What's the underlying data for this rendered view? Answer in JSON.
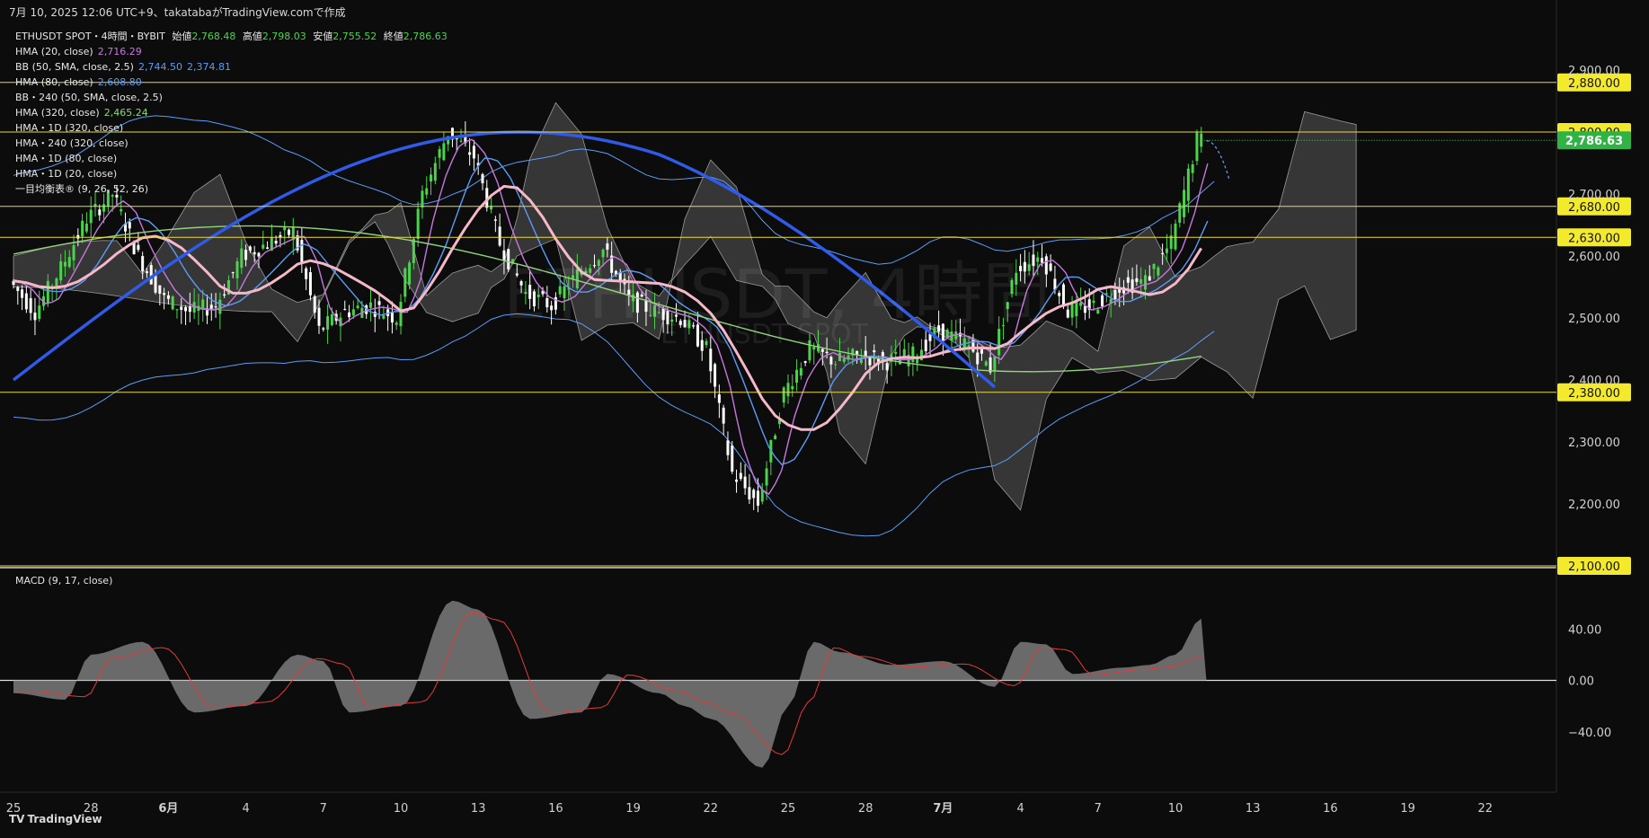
{
  "header": {
    "text": "7月 10, 2025 12:06 UTC+9、takatabaがTradingView.comで作成"
  },
  "symbol_line": {
    "symbol": "ETHUSDT SPOT・4時間・BYBIT",
    "open_label": "始値",
    "open": "2,768.48",
    "high_label": "高値",
    "high": "2,798.03",
    "low_label": "安値",
    "low": "2,755.52",
    "close_label": "終値",
    "close": "2,786.63"
  },
  "indicators": [
    {
      "label": "HMA (20, close)",
      "value": "2,716.29",
      "color": "#c678dd"
    },
    {
      "label": "BB (50, SMA, close, 2.5)",
      "value": "2,744.50",
      "value2": "2,374.81",
      "color": "#5b9cf6"
    },
    {
      "label": "HMA (80, close)",
      "value": "2,608.80",
      "color": "#5b9cf6"
    },
    {
      "label": "BB・240 (50, SMA, close, 2.5)",
      "value": "",
      "color": "#5b9cf6"
    },
    {
      "label": "HMA (320, close)",
      "value": "2,465.24",
      "color": "#8fd47a"
    },
    {
      "label": "HMA・1D (320, close)",
      "value": "",
      "color": "#ffffff"
    },
    {
      "label": "HMA・240 (320, close)",
      "value": "",
      "color": "#ffffff"
    },
    {
      "label": "HMA・1D (80, close)",
      "value": "",
      "color": "#ffffff"
    },
    {
      "label": "HMA・1D (20, close)",
      "value": "",
      "color": "#ffffff"
    },
    {
      "label": "一目均衡表® (9, 26, 52, 26)",
      "value": "",
      "color": "#ffffff"
    }
  ],
  "watermark": {
    "main": "ETHUSDT, 4時間",
    "sub": "ETHUSDT SPOT"
  },
  "macd_label": "MACD (9, 17, close)",
  "price_axis": [
    "2,900.00",
    "2,700.00",
    "2,600.00",
    "2,500.00",
    "2,400.00",
    "2,300.00",
    "2,200.00"
  ],
  "price_levels": [
    {
      "label": "2,880.00",
      "value": 2880
    },
    {
      "label": "2,800.00",
      "value": 2800
    },
    {
      "label": "2,680.00",
      "value": 2680
    },
    {
      "label": "2,630.00",
      "value": 2630
    },
    {
      "label": "2,380.00",
      "value": 2380
    },
    {
      "label": "2,100.00",
      "value": 2100
    }
  ],
  "last_price": {
    "label": "2,786.63",
    "value": 2786.63
  },
  "macd_axis": [
    "40.00",
    "0.00",
    "−40.00"
  ],
  "time_axis": [
    {
      "label": "25",
      "bold": false
    },
    {
      "label": "28",
      "bold": false
    },
    {
      "label": "6月",
      "bold": true
    },
    {
      "label": "4",
      "bold": false
    },
    {
      "label": "7",
      "bold": false
    },
    {
      "label": "10",
      "bold": false
    },
    {
      "label": "13",
      "bold": false
    },
    {
      "label": "16",
      "bold": false
    },
    {
      "label": "19",
      "bold": false
    },
    {
      "label": "22",
      "bold": false
    },
    {
      "label": "25",
      "bold": false
    },
    {
      "label": "28",
      "bold": false
    },
    {
      "label": "7月",
      "bold": true
    },
    {
      "label": "4",
      "bold": false
    },
    {
      "label": "7",
      "bold": false
    },
    {
      "label": "10",
      "bold": false
    },
    {
      "label": "13",
      "bold": false
    },
    {
      "label": "16",
      "bold": false
    },
    {
      "label": "19",
      "bold": false
    },
    {
      "label": "22",
      "bold": false
    }
  ],
  "footer": {
    "logo": "TV",
    "text": "TradingView"
  },
  "colors": {
    "background": "#0c0c0c",
    "up": "#4cd34c",
    "down": "#ffffff",
    "level": "#e8d84a",
    "hma20": "#c678dd",
    "hma80": "#5b9cf6",
    "hma320": "#8fd47a",
    "hma_1d_320": "#2f5be8",
    "hma_240_320": "#f5b8c8",
    "cloud": "#5a5a5a",
    "macd_line": "#e23b3b",
    "macd_hist": "#8a8a8a"
  },
  "chart_data": {
    "type": "candlestick",
    "symbol": "ETHUSDT SPOT",
    "interval": "4時間",
    "exchange": "BYBIT",
    "y_range": [
      2100,
      2930
    ],
    "x_range": [
      "2025-05-25",
      "2025-07-23"
    ],
    "last_ohlc": {
      "open": 2768.48,
      "high": 2798.03,
      "low": 2755.52,
      "close": 2786.63
    },
    "price_path": [
      {
        "x": "05-25",
        "y": 2560
      },
      {
        "x": "05-26",
        "y": 2510
      },
      {
        "x": "05-27",
        "y": 2580
      },
      {
        "x": "05-28",
        "y": 2660
      },
      {
        "x": "05-29",
        "y": 2700
      },
      {
        "x": "05-30",
        "y": 2600
      },
      {
        "x": "05-31",
        "y": 2530
      },
      {
        "x": "06-01",
        "y": 2510
      },
      {
        "x": "06-02",
        "y": 2520
      },
      {
        "x": "06-03",
        "y": 2600
      },
      {
        "x": "06-04",
        "y": 2620
      },
      {
        "x": "06-05",
        "y": 2640
      },
      {
        "x": "06-06",
        "y": 2480
      },
      {
        "x": "06-07",
        "y": 2510
      },
      {
        "x": "06-08",
        "y": 2520
      },
      {
        "x": "06-09",
        "y": 2500
      },
      {
        "x": "06-10",
        "y": 2700
      },
      {
        "x": "06-11",
        "y": 2800
      },
      {
        "x": "06-12",
        "y": 2760
      },
      {
        "x": "06-13",
        "y": 2620
      },
      {
        "x": "06-14",
        "y": 2540
      },
      {
        "x": "06-15",
        "y": 2520
      },
      {
        "x": "06-16",
        "y": 2570
      },
      {
        "x": "06-17",
        "y": 2610
      },
      {
        "x": "06-18",
        "y": 2530
      },
      {
        "x": "06-19",
        "y": 2510
      },
      {
        "x": "06-20",
        "y": 2500
      },
      {
        "x": "06-21",
        "y": 2450
      },
      {
        "x": "06-22",
        "y": 2250
      },
      {
        "x": "06-23",
        "y": 2200
      },
      {
        "x": "06-24",
        "y": 2380
      },
      {
        "x": "06-25",
        "y": 2450
      },
      {
        "x": "06-26",
        "y": 2430
      },
      {
        "x": "06-27",
        "y": 2440
      },
      {
        "x": "06-28",
        "y": 2430
      },
      {
        "x": "06-29",
        "y": 2440
      },
      {
        "x": "06-30",
        "y": 2480
      },
      {
        "x": "07-01",
        "y": 2460
      },
      {
        "x": "07-02",
        "y": 2420
      },
      {
        "x": "07-03",
        "y": 2580
      },
      {
        "x": "07-04",
        "y": 2600
      },
      {
        "x": "07-05",
        "y": 2510
      },
      {
        "x": "07-06",
        "y": 2520
      },
      {
        "x": "07-07",
        "y": 2550
      },
      {
        "x": "07-08",
        "y": 2560
      },
      {
        "x": "07-09",
        "y": 2620
      },
      {
        "x": "07-10",
        "y": 2786.63
      }
    ],
    "series": [
      {
        "name": "HMA (20, close)",
        "last": 2716.29
      },
      {
        "name": "HMA (80, close)",
        "last": 2608.8
      },
      {
        "name": "HMA (320, close)",
        "last": 2465.24
      },
      {
        "name": "BB (50, SMA, close, 2.5)",
        "upper": 2744.5,
        "lower": 2374.81
      }
    ],
    "macd": {
      "name": "MACD (9, 17, close)",
      "y_range": [
        -80,
        80
      ],
      "histogram": [
        {
          "x": "05-25",
          "y": -10
        },
        {
          "x": "05-27",
          "y": -15
        },
        {
          "x": "05-28",
          "y": 20
        },
        {
          "x": "05-30",
          "y": 30
        },
        {
          "x": "06-01",
          "y": -25
        },
        {
          "x": "06-03",
          "y": -20
        },
        {
          "x": "06-05",
          "y": 20
        },
        {
          "x": "06-06",
          "y": 15
        },
        {
          "x": "06-07",
          "y": -25
        },
        {
          "x": "06-09",
          "y": -20
        },
        {
          "x": "06-11",
          "y": 62
        },
        {
          "x": "06-12",
          "y": 55
        },
        {
          "x": "06-14",
          "y": -30
        },
        {
          "x": "06-16",
          "y": -25
        },
        {
          "x": "06-17",
          "y": 5
        },
        {
          "x": "06-19",
          "y": -10
        },
        {
          "x": "06-20",
          "y": -20
        },
        {
          "x": "06-21",
          "y": -30
        },
        {
          "x": "06-23",
          "y": -68
        },
        {
          "x": "06-24",
          "y": -20
        },
        {
          "x": "06-25",
          "y": 30
        },
        {
          "x": "06-26",
          "y": 22
        },
        {
          "x": "06-28",
          "y": 12
        },
        {
          "x": "06-30",
          "y": 15
        },
        {
          "x": "07-02",
          "y": -5
        },
        {
          "x": "07-03",
          "y": 30
        },
        {
          "x": "07-04",
          "y": 28
        },
        {
          "x": "07-05",
          "y": 5
        },
        {
          "x": "07-07",
          "y": 10
        },
        {
          "x": "07-08",
          "y": 12
        },
        {
          "x": "07-09",
          "y": 20
        },
        {
          "x": "07-10",
          "y": 48
        }
      ]
    }
  }
}
